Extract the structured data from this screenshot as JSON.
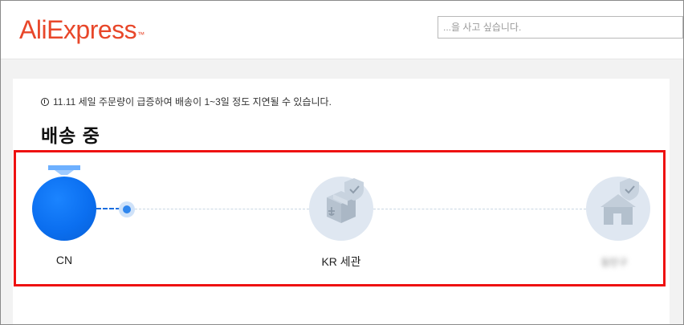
{
  "header": {
    "logo": "AliExpress",
    "logo_mark": "™",
    "search_placeholder": "...을 사고 싶습니다."
  },
  "shipment": {
    "notice": "11.11 세일 주문량이 급증하여 배송이 1~3일 정도 지연될 수 있습니다.",
    "status": "배송 중",
    "stages": [
      {
        "label": "CN",
        "state": "completed"
      },
      {
        "label": "KR 세관",
        "state": "pending"
      },
      {
        "label": "동탄구",
        "state": "pending",
        "blurred": true
      }
    ]
  },
  "colors": {
    "brand": "#e8472a",
    "progress_blue": "#0b6ff0",
    "pending_node": "#dfe7f1",
    "highlight": "#ee1111"
  },
  "icons": {
    "origin": "blue-globe-icon",
    "customs": "package-shield-icon",
    "destination": "house-shield-icon",
    "notice": "info-circle-icon"
  }
}
